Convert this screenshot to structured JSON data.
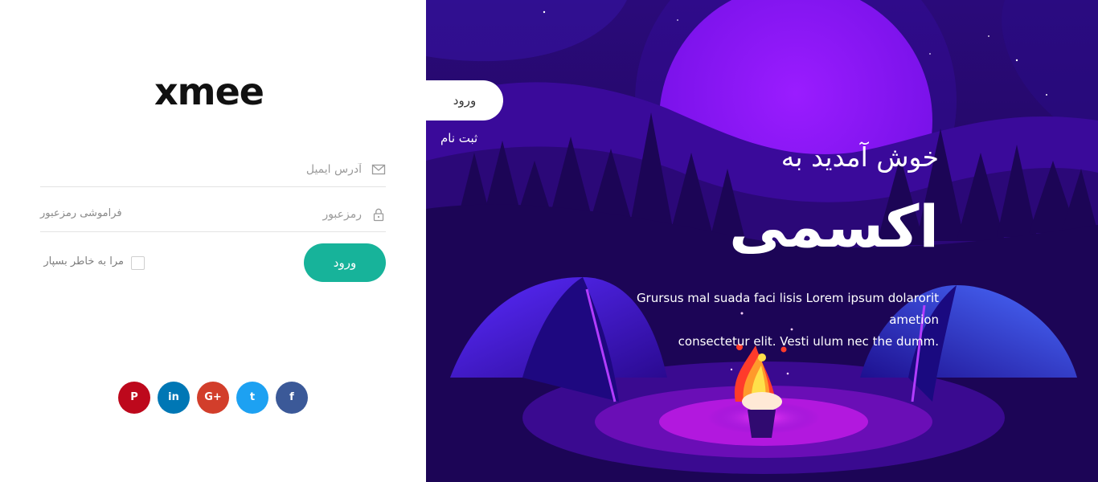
{
  "brand": {
    "logo_text": "xmee"
  },
  "login_form": {
    "email_placeholder": "آدرس ایمیل",
    "password_placeholder": "رمزعبور",
    "forgot_password": "فراموشی رمزعبور",
    "remember_me": "مرا به خاطر بسپار",
    "submit_label": "ورود"
  },
  "social": [
    {
      "name": "pinterest",
      "glyph": "P",
      "color": "#bd081c"
    },
    {
      "name": "linkedin",
      "glyph": "in",
      "color": "#0077b5"
    },
    {
      "name": "google-plus",
      "glyph": "G+",
      "color": "#d23e2b"
    },
    {
      "name": "twitter",
      "glyph": "t",
      "color": "#1da1f2"
    },
    {
      "name": "facebook",
      "glyph": "f",
      "color": "#3b5998"
    }
  ],
  "tabs": {
    "login": "ورود",
    "register": "ثبت نام"
  },
  "hero": {
    "welcome": "خوش آمدید به",
    "brand_name": "اکسمی",
    "tagline_line1": "Grursus mal suada faci lisis Lorem ipsum dolarorit ametion",
    "tagline_line2": ".consectetur elit. Vesti ulum nec the dumm"
  },
  "colors": {
    "accent": "#17b39a",
    "hero_background": "#1d0650",
    "moon": "#8a10ff"
  }
}
